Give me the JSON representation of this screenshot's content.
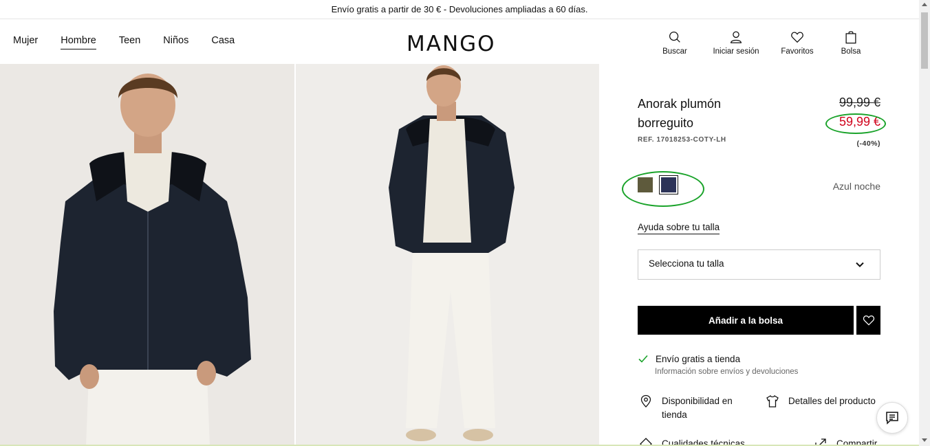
{
  "promo": "Envío gratis a partir de 30 € - Devoluciones ampliadas a 60 días.",
  "nav": {
    "items": [
      {
        "label": "Mujer"
      },
      {
        "label": "Hombre"
      },
      {
        "label": "Teen"
      },
      {
        "label": "Niños"
      },
      {
        "label": "Casa"
      }
    ],
    "active": "Hombre"
  },
  "logo": "MANGO",
  "tools": {
    "search": "Buscar",
    "login": "Iniciar sesión",
    "favorites": "Favoritos",
    "bag": "Bolsa"
  },
  "product": {
    "title": "Anorak plumón borreguito",
    "ref": "REF. 17018253-COTY-LH",
    "old_price": "99,99 €",
    "new_price": "59,99 €",
    "discount": "(-40%)",
    "color_name": "Azul noche",
    "colors": [
      "#5e5a3c",
      "#2c3358"
    ]
  },
  "size": {
    "help": "Ayuda sobre tu talla",
    "select_placeholder": "Selecciona tu talla"
  },
  "actions": {
    "add_to_bag": "Añadir a la bolsa"
  },
  "shipping": {
    "title": "Envío gratis a tienda",
    "info": "Información sobre envíos y devoluciones"
  },
  "features": {
    "availability": "Disponibilidad en tienda",
    "details": "Detalles del producto",
    "tech": "Cualidades técnicas",
    "share": "Compartir"
  },
  "accent": {
    "sale": "#d0021b",
    "highlight": "#1aa32a"
  }
}
